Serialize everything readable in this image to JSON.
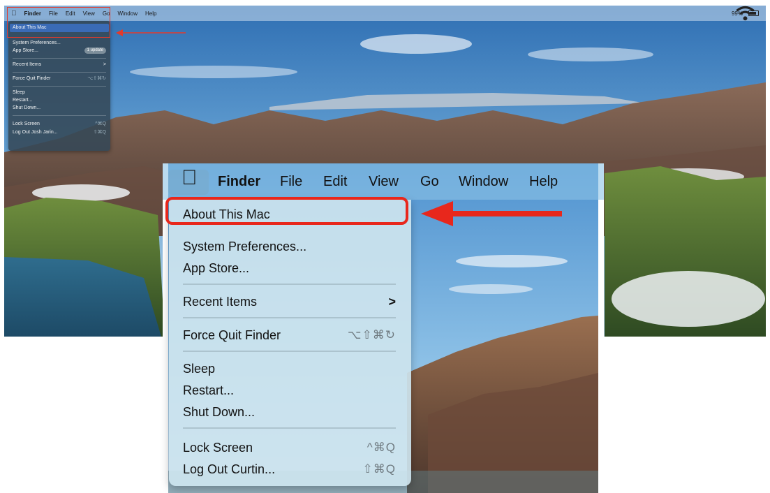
{
  "colors": {
    "annotation_red": "#e8271c",
    "menu_dark": "#344856",
    "menu_light": "#cde4ee"
  },
  "small": {
    "menubar": {
      "apple_icon": "apple-logo-icon",
      "items": [
        "Finder",
        "File",
        "Edit",
        "View",
        "Go",
        "Window",
        "Help"
      ],
      "battery": "99%",
      "wifi_icon": "wifi-icon"
    },
    "menu": {
      "about": "About This Mac",
      "system_prefs": "System Preferences...",
      "app_store": "App Store...",
      "app_store_badge": "1 update",
      "recent": "Recent Items",
      "recent_chevron": ">",
      "force_quit": "Force Quit Finder",
      "force_quit_sc": "⌥⇧⌘↻",
      "sleep": "Sleep",
      "restart": "Restart...",
      "shutdown": "Shut Down...",
      "lock": "Lock Screen",
      "lock_sc": "^⌘Q",
      "logout": "Log Out Josh Jarin...",
      "logout_sc": "⇧⌘Q"
    }
  },
  "zoom": {
    "menubar": {
      "apple_icon": "apple-logo-icon",
      "items": [
        "Finder",
        "File",
        "Edit",
        "View",
        "Go",
        "Window",
        "Help"
      ]
    },
    "menu": {
      "about": "About This Mac",
      "system_prefs": "System Preferences...",
      "app_store": "App Store...",
      "recent": "Recent Items",
      "recent_chevron": ">",
      "force_quit": "Force Quit Finder",
      "force_quit_sc": "⌥⇧⌘↻",
      "sleep": "Sleep",
      "restart": "Restart...",
      "shutdown": "Shut Down...",
      "lock": "Lock Screen",
      "lock_sc": "^⌘Q",
      "logout": "Log Out Curtin...",
      "logout_sc": "⇧⌘Q"
    }
  }
}
